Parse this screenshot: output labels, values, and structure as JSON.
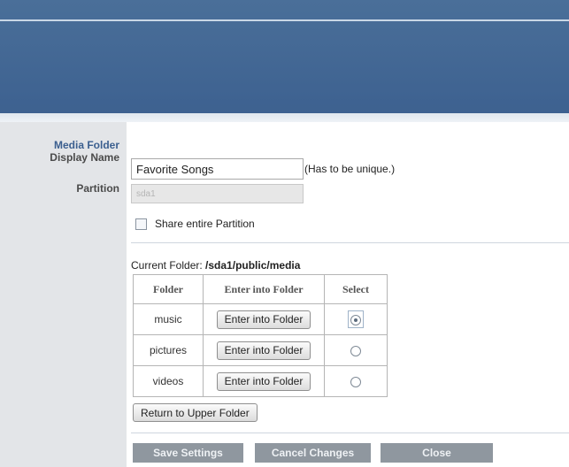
{
  "labels": {
    "media_folder": "Media Folder",
    "display_name": "Display Name",
    "partition": "Partition"
  },
  "form": {
    "display_name_value": "Favorite Songs",
    "unique_hint": "(Has to be unique.)",
    "partition_value": "sda1",
    "share_label": "Share entire Partition"
  },
  "current_folder": {
    "label": "Current Folder:",
    "path": "/sda1/public/media"
  },
  "table": {
    "headers": [
      "Folder",
      "Enter into Folder",
      "Select"
    ],
    "rows": [
      {
        "folder": "music",
        "button": "Enter into Folder",
        "selected": true
      },
      {
        "folder": "pictures",
        "button": "Enter into Folder",
        "selected": false
      },
      {
        "folder": "videos",
        "button": "Enter into Folder",
        "selected": false
      }
    ]
  },
  "return_button": "Return to Upper Folder",
  "actions": {
    "save": "Save Settings",
    "cancel": "Cancel Changes",
    "close": "Close"
  }
}
